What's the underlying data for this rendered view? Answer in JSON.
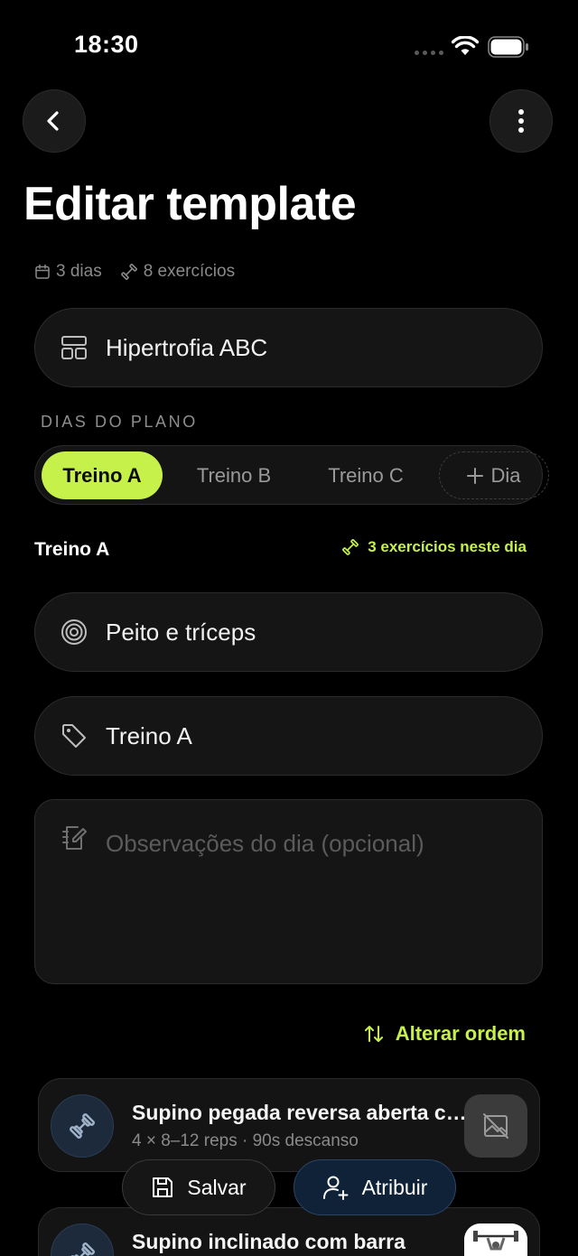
{
  "status_bar": {
    "time": "18:30"
  },
  "header": {
    "title": "Editar template"
  },
  "meta": {
    "days": "3 dias",
    "exercises": "8 exercícios"
  },
  "template": {
    "name": "Hipertrofia ABC"
  },
  "plan_days": {
    "section_label": "DIAS DO PLANO",
    "tabs": [
      {
        "label": "Treino A",
        "active": true
      },
      {
        "label": "Treino B",
        "active": false
      },
      {
        "label": "Treino C",
        "active": false
      }
    ],
    "add_label": "Dia"
  },
  "day": {
    "title": "Treino A",
    "exercise_count": "3 exercícios neste dia",
    "focus": "Peito e tríceps",
    "label": "Treino A",
    "notes_placeholder": "Observações do dia (opcional)",
    "reorder_label": "Alterar ordem"
  },
  "exercises": [
    {
      "name": "Supino pegada reversa aberta c…",
      "detail": "4 × 8–12 reps · 90s descanso"
    },
    {
      "name": "Supino inclinado com barra",
      "detail": ""
    }
  ],
  "actions": {
    "save_label": "Salvar",
    "assign_label": "Atribuir"
  },
  "colors": {
    "accent": "#c6f04a",
    "background": "#000000",
    "card": "#151515",
    "assign": "#0f2238"
  }
}
